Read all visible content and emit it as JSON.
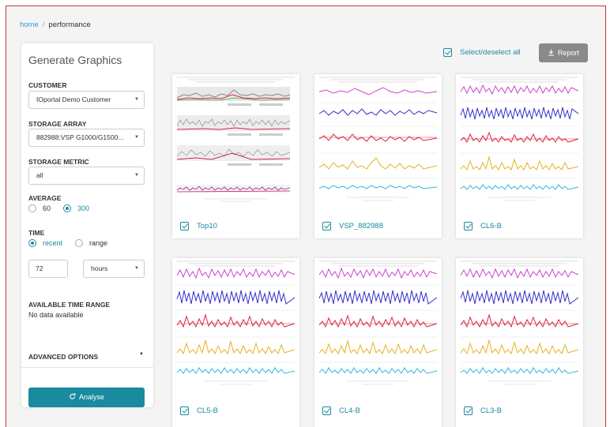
{
  "breadcrumb": {
    "home": "home",
    "separator": "/",
    "current": "performance"
  },
  "sidebar": {
    "title": "Generate Graphics",
    "customer": {
      "label": "CUSTOMER",
      "value": "IOportal Demo Customer"
    },
    "storage_array": {
      "label": "STORAGE ARRAY",
      "value": "882988:VSP G1000/G1500..."
    },
    "storage_metric": {
      "label": "STORAGE METRIC",
      "value": "all"
    },
    "average": {
      "label": "AVERAGE",
      "options": [
        "60",
        "300"
      ],
      "selected": "300"
    },
    "time": {
      "label": "TIME",
      "options": [
        "recent",
        "range"
      ],
      "selected": "recent"
    },
    "time_amount": "72",
    "time_unit": "hours",
    "available_range": {
      "label": "AVAILABLE TIME RANGE",
      "value": "No data available"
    },
    "advanced_options": "ADVANCED OPTIONS",
    "analyse_button": "Analyse"
  },
  "toolbar": {
    "select_all": "Select/deselect all",
    "report_button": "Report"
  },
  "cards": [
    {
      "label": "Top10",
      "checked": true
    },
    {
      "label": "VSP_882988",
      "checked": true
    },
    {
      "label": "CL6-B",
      "checked": true
    },
    {
      "label": "CL5-B",
      "checked": true
    },
    {
      "label": "CL4-B",
      "checked": true
    },
    {
      "label": "CL3-B",
      "checked": true
    }
  ],
  "colors": {
    "accent": "#1a8a9f",
    "link": "#2a9fd6",
    "report_button": "#8a8a8a",
    "series": [
      "#cc44cc",
      "#3333cc",
      "#dd2244",
      "#e8b020",
      "#33b5dd"
    ]
  },
  "icons": {
    "select_caret": "caret-down-icon",
    "refresh": "refresh-icon",
    "download": "download-icon",
    "checkbox": "checkbox-checked-icon"
  }
}
